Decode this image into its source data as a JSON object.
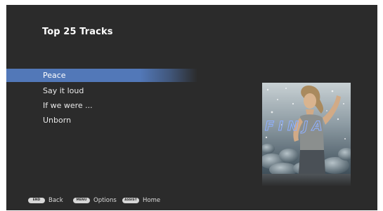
{
  "page": {
    "title": "Top 25 Tracks"
  },
  "tracks": [
    {
      "label": "Peace",
      "selected": true
    },
    {
      "label": "Say it loud",
      "selected": false
    },
    {
      "label": "If we were ...",
      "selected": false
    },
    {
      "label": "Unborn",
      "selected": false
    }
  ],
  "album_art": {
    "logo_text": "FINJA"
  },
  "footer": {
    "back": {
      "key": "END",
      "label": "Back"
    },
    "options": {
      "key": "MENU",
      "label": "Options"
    },
    "home": {
      "key": "ASSIST",
      "label": "Home"
    }
  },
  "colors": {
    "background": "#2b2b2b",
    "selection": "#5278b8",
    "text": "#e8e8e8"
  }
}
